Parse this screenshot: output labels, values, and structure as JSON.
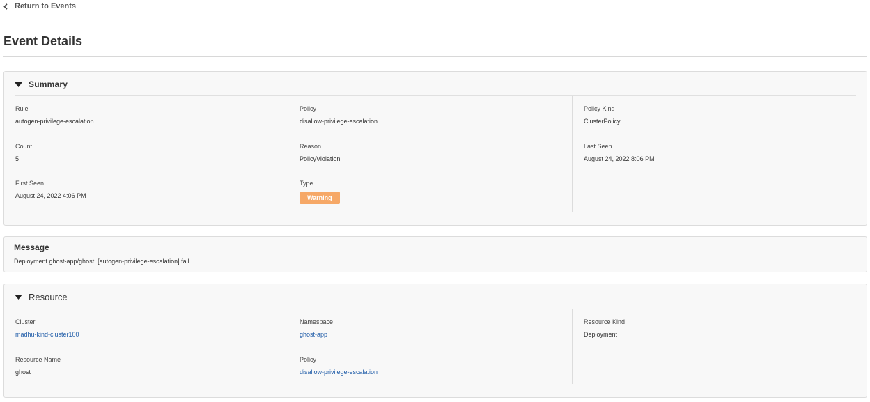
{
  "nav": {
    "back_label": "Return to Events"
  },
  "page": {
    "title": "Event Details"
  },
  "summary": {
    "title": "Summary",
    "rule_label": "Rule",
    "rule_value": "autogen-privilege-escalation",
    "count_label": "Count",
    "count_value": "5",
    "first_seen_label": "First Seen",
    "first_seen_value": "August 24, 2022 4:06 PM",
    "policy_label": "Policy",
    "policy_value": "disallow-privilege-escalation",
    "reason_label": "Reason",
    "reason_value": "PolicyViolation",
    "type_label": "Type",
    "type_value": "Warning",
    "policy_kind_label": "Policy Kind",
    "policy_kind_value": "ClusterPolicy",
    "last_seen_label": "Last Seen",
    "last_seen_value": "August 24, 2022 8:06 PM"
  },
  "message": {
    "title": "Message",
    "text": "Deployment ghost-app/ghost: [autogen-privilege-escalation] fail"
  },
  "resource": {
    "title": "Resource",
    "cluster_label": "Cluster",
    "cluster_value": "madhu-kind-cluster100",
    "resource_name_label": "Resource Name",
    "resource_name_value": "ghost",
    "namespace_label": "Namespace",
    "namespace_value": "ghost-app",
    "policy_label": "Policy",
    "policy_value": "disallow-privilege-escalation",
    "resource_kind_label": "Resource Kind",
    "resource_kind_value": "Deployment"
  },
  "colors": {
    "link": "#1f5ca8",
    "warning_badge": "#f6a867",
    "card_background": "#f8f8f8"
  },
  "icons": {
    "back": "chevron-left-icon",
    "collapse": "caret-down-icon"
  }
}
